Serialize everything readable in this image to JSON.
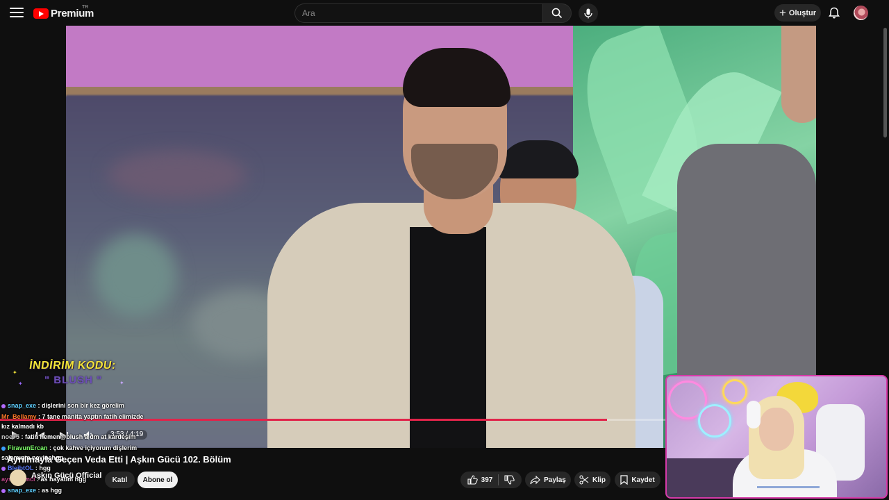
{
  "header": {
    "logo": "Premium",
    "region": "TR",
    "search_placeholder": "Ara",
    "create_label": "Oluştur"
  },
  "promo": {
    "line1": "İNDİRİM KODU:",
    "line2": "\" BLUSH \""
  },
  "player": {
    "time": "3:53 / 4:19",
    "progress": 0.91
  },
  "chat": [
    {
      "user": "snap_exe",
      "text": "dişlerini son bir kez görelim",
      "color": "#5fd0ff",
      "badge": "#b36bff"
    },
    {
      "user": "Mr_Bellamy",
      "text": "7 tane manita yaptın fatih elimizde",
      "color": "#ff7b2b",
      "badge": ""
    },
    {
      "user": "",
      "text": "kız kalmadı kb",
      "color": "#ffffff",
      "badge": "",
      "wrap": true
    },
    {
      "user": "noe75",
      "text": "fatih hemen@blush a dm at kardeşim",
      "color": "#c9c9c9",
      "badge": ""
    },
    {
      "user": "FiravunErcan",
      "text": "çok kahve içiyorum dişlerim",
      "color": "#7dff6a",
      "badge": "#3aa0ff"
    },
    {
      "user": "",
      "text": "salamınm neyinehgg",
      "color": "#ffffff",
      "badge": "",
      "wrap": true
    },
    {
      "user": "BleibtOL",
      "text": "hgg",
      "color": "#5a7bff",
      "badge": "#b36bff"
    },
    {
      "user": "aysenaimci",
      "text": "as hayatım hgg",
      "color": "#c04a8a",
      "badge": ""
    },
    {
      "user": "snap_exe",
      "text": "as hgg",
      "color": "#5fd0ff",
      "badge": "#b36bff"
    }
  ],
  "video_info": {
    "title": "Ayrılmayla Geçen Veda Etti | Aşkın Gücü 102. Bölüm",
    "channel": "Aşkın Gücü Official",
    "subscribers": "",
    "join_label": "Katıl",
    "subscribe_label": "Abone ol",
    "likes": "397",
    "share_label": "Paylaş",
    "clip_label": "Klip",
    "save_label": "Kaydet"
  },
  "colors": {
    "accent": "#e0244a",
    "brand": "#ff0000",
    "cam_border": "#d63aa8"
  }
}
